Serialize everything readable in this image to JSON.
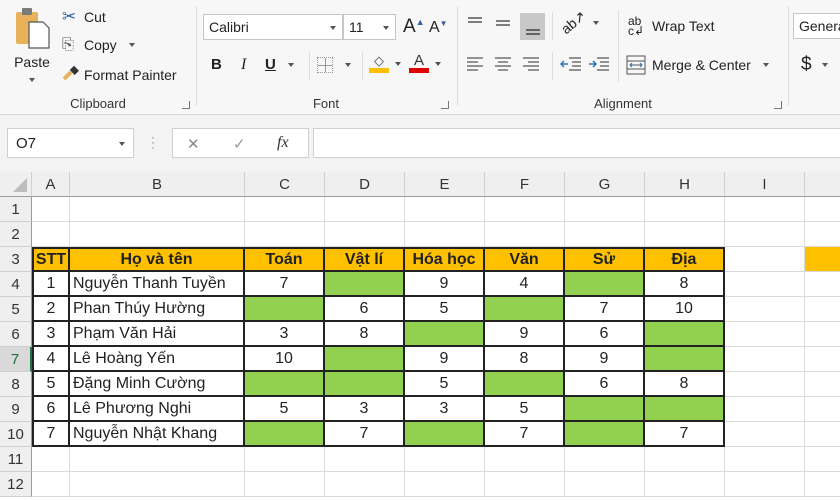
{
  "ribbon": {
    "clipboard": {
      "label": "Clipboard",
      "paste": "Paste",
      "cut": "Cut",
      "copy": "Copy",
      "format_painter": "Format Painter"
    },
    "font": {
      "label": "Font",
      "font_name": "Calibri",
      "font_size": "11",
      "bold": "B",
      "italic": "I",
      "underline": "U",
      "grow": "A",
      "shrink": "A",
      "fill_color": "#ffc000",
      "font_color": "#e00000"
    },
    "alignment": {
      "label": "Alignment",
      "wrap_text": "Wrap Text",
      "merge_center": "Merge & Center"
    },
    "number": {
      "format": "General",
      "currency": "$"
    }
  },
  "formula_bar": {
    "name_box": "O7",
    "cancel": "✕",
    "enter": "✓",
    "fx": "fx",
    "formula": ""
  },
  "columns": [
    "A",
    "B",
    "C",
    "D",
    "E",
    "F",
    "G",
    "H",
    "I",
    ""
  ],
  "rows": [
    "1",
    "2",
    "3",
    "4",
    "5",
    "6",
    "7",
    "8",
    "9",
    "10",
    "11",
    "12"
  ],
  "active_row": "7",
  "table": {
    "headers": [
      "STT",
      "Họ và tên",
      "Toán",
      "Vật lí",
      "Hóa học",
      "Văn",
      "Sử",
      "Địa"
    ],
    "header_color": "#ffc000",
    "blank_color": "#92d050",
    "records": [
      [
        "1",
        "Nguyễn Thanh Tuyền",
        "7",
        "",
        "9",
        "4",
        "",
        "8"
      ],
      [
        "2",
        "Phan Thúy Hường",
        "",
        "6",
        "5",
        "",
        "7",
        "10"
      ],
      [
        "3",
        "Phạm Văn Hải",
        "3",
        "8",
        "",
        "9",
        "6",
        ""
      ],
      [
        "4",
        "Lê Hoàng Yến",
        "10",
        "",
        "9",
        "8",
        "9",
        ""
      ],
      [
        "5",
        "Đặng Minh Cường",
        "",
        "",
        "5",
        "",
        "6",
        "8"
      ],
      [
        "6",
        "Lê Phương Nghi",
        "5",
        "3",
        "3",
        "5",
        "",
        ""
      ],
      [
        "7",
        "Nguyễn Nhật Khang",
        "",
        "7",
        "",
        "7",
        "",
        "7"
      ]
    ]
  }
}
